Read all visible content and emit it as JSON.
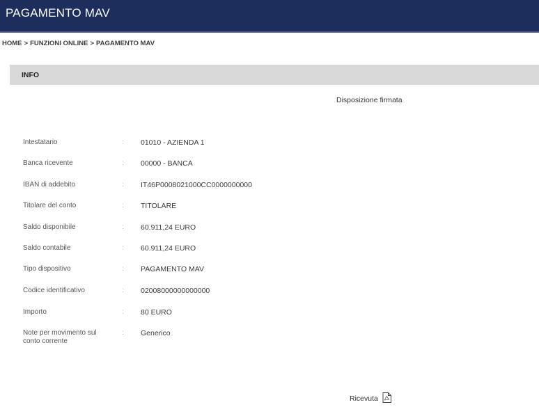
{
  "header": {
    "title": "PAGAMENTO MAV"
  },
  "breadcrumb": {
    "home": "HOME",
    "section": "FUNZIONI ONLINE",
    "current": "PAGAMENTO MAV",
    "separator": ">"
  },
  "info": {
    "title": "INFO"
  },
  "status": "Disposizione firmata",
  "rows": [
    {
      "label": "Intestatario",
      "colon": ":",
      "value": "01010 - AZIENDA 1"
    },
    {
      "label": "Banca ricevente",
      "colon": ":",
      "value": "00000 - BANCA"
    },
    {
      "label": "IBAN di addebito",
      "colon": ":",
      "value": "IT46P0008021000CC0000000000"
    },
    {
      "label": "Titolare del conto",
      "colon": ":",
      "value": "TITOLARE"
    },
    {
      "label": "Saldo disponibile",
      "colon": ":",
      "value": "60.911,24  EURO"
    },
    {
      "label": "Saldo contabile",
      "colon": ":",
      "value": "60.911,24  EURO"
    },
    {
      "label": "Tipo dispositivo",
      "colon": ":",
      "value": "PAGAMENTO MAV"
    },
    {
      "label": "Codice identificativo",
      "colon": ":",
      "value": "02008000000000000"
    },
    {
      "label": "Importo",
      "colon": ":",
      "value": "80  EURO"
    },
    {
      "label": "Note per movimento sul",
      "label2": "conto corrente",
      "colon": ":",
      "value": "Generico"
    }
  ],
  "receipt": {
    "label": "Ricevuta",
    "icon": "pdf-document-icon"
  },
  "colors": {
    "header_bg": "#1d2d5c",
    "info_bar_bg": "#d9d9d9"
  }
}
